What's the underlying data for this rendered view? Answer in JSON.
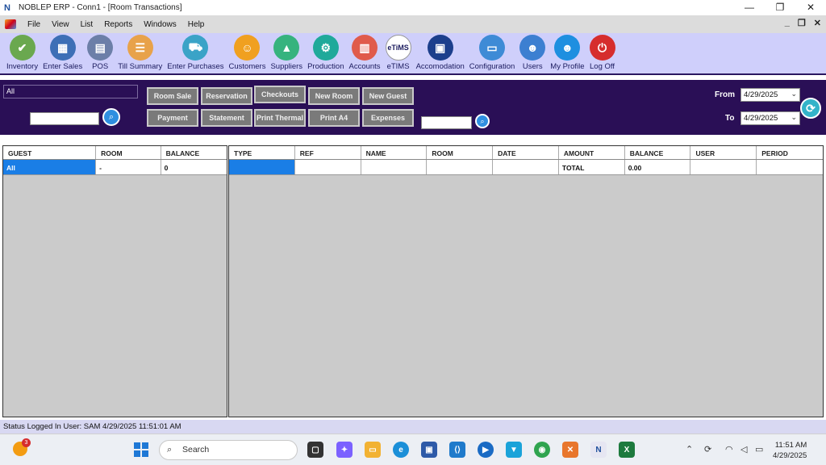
{
  "window": {
    "title": "NOBLEP ERP - Conn1 - [Room Transactions]",
    "controls": {
      "minimize": "—",
      "restore": "❐",
      "close": "✕"
    }
  },
  "menu": [
    "File",
    "View",
    "List",
    "Reports",
    "Windows",
    "Help"
  ],
  "mdi_controls": {
    "minimize": "_",
    "restore": "❐",
    "close": "✕"
  },
  "toolbar": [
    {
      "label": "Inventory",
      "icon": "inventory-icon",
      "color": "#6aa84f",
      "glyph": "✔"
    },
    {
      "label": "Enter Sales",
      "icon": "calculator-icon",
      "color": "#3d6fb6",
      "glyph": "▦"
    },
    {
      "label": "POS",
      "icon": "pos-icon",
      "color": "#6c7fa8",
      "glyph": "▤"
    },
    {
      "label": "Till Summary",
      "icon": "clipboard-icon",
      "color": "#e8a24a",
      "glyph": "☰"
    },
    {
      "label": "Enter Purchases",
      "icon": "cart-icon",
      "color": "#3aa3c7",
      "glyph": "⛟"
    },
    {
      "label": "Customers",
      "icon": "customers-icon",
      "color": "#f0a020",
      "glyph": "☺"
    },
    {
      "label": "Suppliers",
      "icon": "suppliers-icon",
      "color": "#36b37e",
      "glyph": "▲"
    },
    {
      "label": "Production",
      "icon": "production-icon",
      "color": "#1fa99a",
      "glyph": "⚙"
    },
    {
      "label": "Accounts",
      "icon": "accounts-icon",
      "color": "#e05b4b",
      "glyph": "▥"
    },
    {
      "label": "eTIMS",
      "icon": "etims-icon",
      "color": "#ffffff",
      "glyph": "eTiMS"
    },
    {
      "label": "Accomodation",
      "icon": "hotel-icon",
      "color": "#1c3f8c",
      "glyph": "▣"
    },
    {
      "label": "Configuration",
      "icon": "monitor-icon",
      "color": "#3e8bd6",
      "glyph": "▭"
    },
    {
      "label": "Users",
      "icon": "users-icon",
      "color": "#3c7fd1",
      "glyph": "☻"
    },
    {
      "label": "My Profile",
      "icon": "profile-icon",
      "color": "#1e8fe0",
      "glyph": "☻"
    },
    {
      "label": "Log Off",
      "icon": "logoff-icon",
      "color": "#d62d2d",
      "glyph": "⏻"
    }
  ],
  "filter": {
    "guest_select": "All",
    "buttons_row1": [
      "Room Sale",
      "Reservation",
      "Checkouts",
      "New Room",
      "New Guest"
    ],
    "buttons_row2": [
      "Payment",
      "Statement",
      "Print Thermal",
      "Print A4",
      "Expenses"
    ],
    "from_label": "From",
    "to_label": "To",
    "from_date": "4/29/2025",
    "to_date": "4/29/2025"
  },
  "guest_grid": {
    "columns": [
      "GUEST",
      "ROOM",
      "BALANCE"
    ],
    "rows": [
      [
        "All",
        "-",
        "0"
      ]
    ]
  },
  "transactions_grid": {
    "columns": [
      "TYPE",
      "REF",
      "NAME",
      "ROOM",
      "DATE",
      "AMOUNT",
      "BALANCE",
      "USER",
      "PERIOD"
    ],
    "rows": [
      [
        "",
        "",
        "",
        "",
        "",
        "TOTAL",
        "0.00",
        "",
        ""
      ]
    ]
  },
  "status": "Status  Logged In User: SAM  4/29/2025 11:51:01 AM",
  "taskbar": {
    "search_placeholder": "Search",
    "badge_count": "3",
    "time": "11:51 AM",
    "date": "4/29/2025"
  }
}
